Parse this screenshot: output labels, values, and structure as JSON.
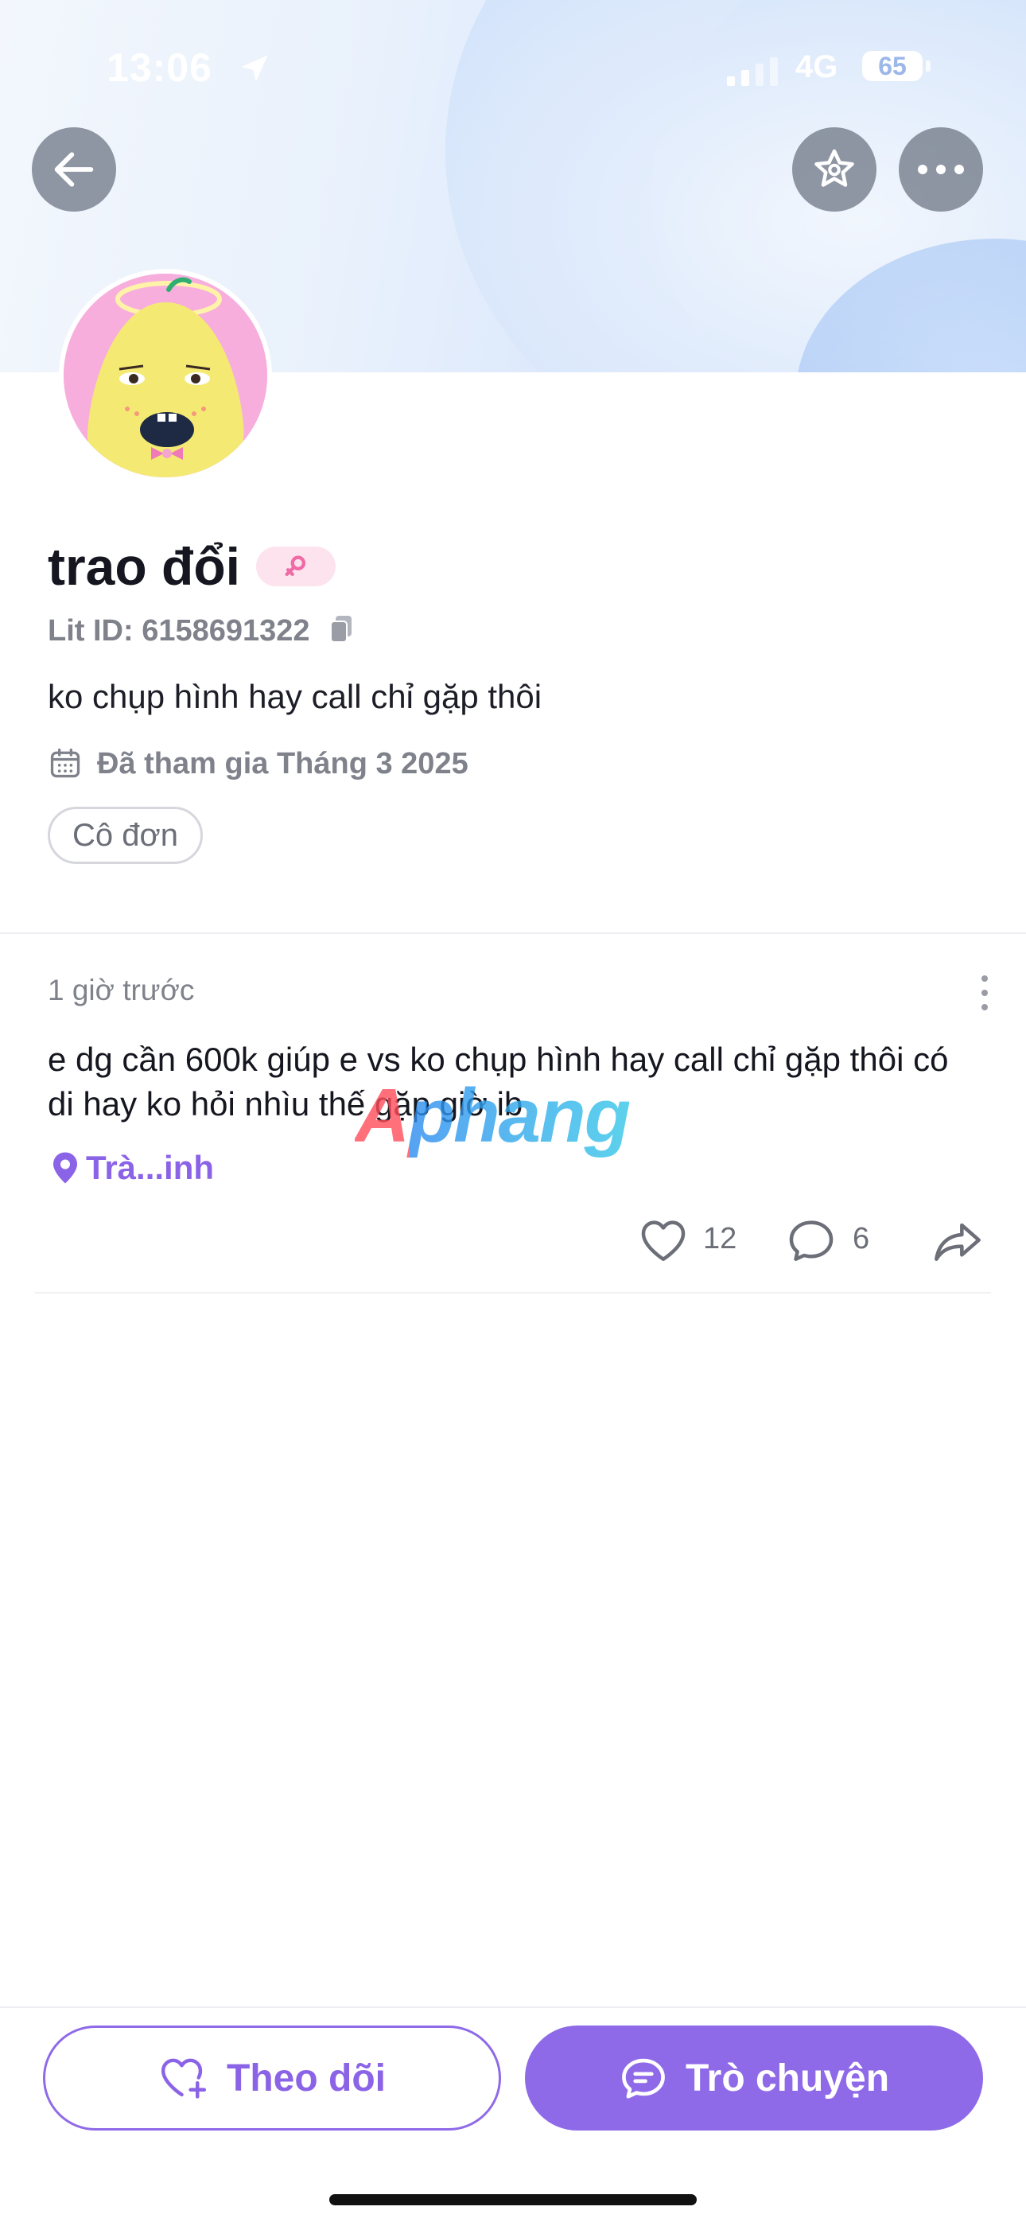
{
  "status_bar": {
    "time": "13:06",
    "network": "4G",
    "battery": "65"
  },
  "profile": {
    "name": "trao đổi",
    "lit_id": "Lit ID: 6158691322",
    "bio": "ko chụp hình hay call chỉ gặp thôi",
    "joined": "Đã tham gia Tháng 3 2025",
    "tag": "Cô đơn"
  },
  "post": {
    "time": "1 giờ trước",
    "text": "e dg cần 600k giúp e vs ko chụp hình hay call chỉ gặp thôi có di hay ko hỏi nhìu thế gặp giờ ib",
    "location": "Trà...inh",
    "likes": "12",
    "comments": "6"
  },
  "watermark": "Aphang",
  "buttons": {
    "follow": "Theo dõi",
    "chat": "Trò chuyện"
  },
  "colors": {
    "accent": "#8f6ae8",
    "gender_badge_bg": "#fde3ee",
    "gender_icon": "#f06aa5",
    "avatar_bg": "#f7aedd"
  },
  "icons": [
    "back-arrow-icon",
    "star-icon",
    "more-icon",
    "female-icon",
    "copy-icon",
    "calendar-icon",
    "location-pin-icon",
    "heart-icon",
    "comment-icon",
    "share-icon",
    "heart-plus-icon",
    "chat-bubble-icon"
  ]
}
